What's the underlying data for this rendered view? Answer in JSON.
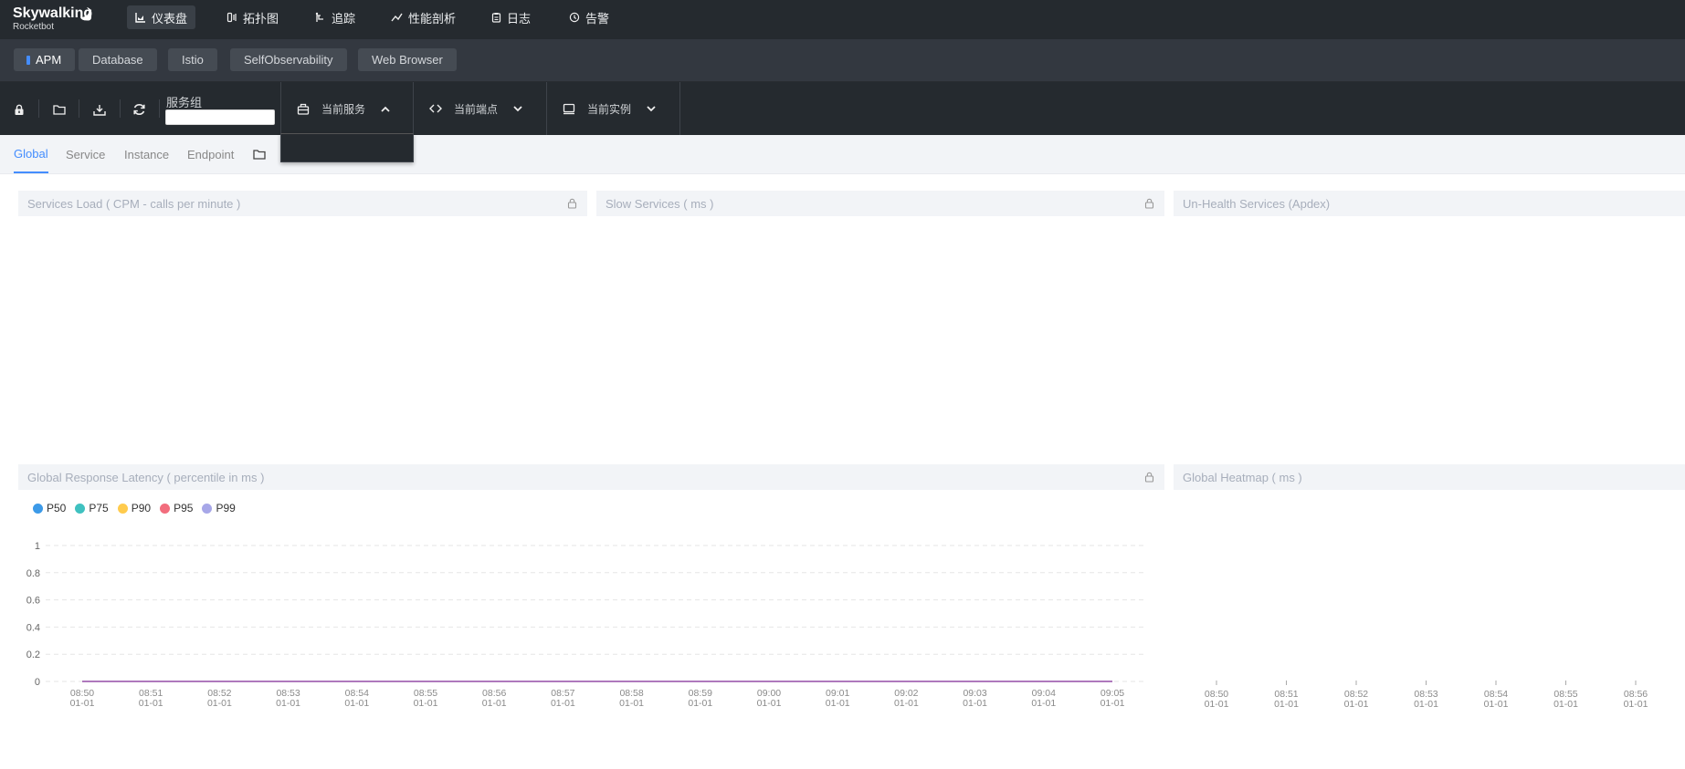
{
  "brand": {
    "name": "Skywalking",
    "sub": "Rocketbot"
  },
  "nav": [
    {
      "label": "仪表盘",
      "icon": "dashboard-chart-icon",
      "active": true
    },
    {
      "label": "拓扑图",
      "icon": "topology-icon",
      "active": false
    },
    {
      "label": "追踪",
      "icon": "trace-icon",
      "active": false
    },
    {
      "label": "性能剖析",
      "icon": "profile-trend-icon",
      "active": false
    },
    {
      "label": "日志",
      "icon": "log-clipboard-icon",
      "active": false
    },
    {
      "label": "告警",
      "icon": "alarm-clock-icon",
      "active": false
    }
  ],
  "layers": [
    {
      "label": "APM",
      "active": true
    },
    {
      "label": "Database",
      "active": false
    },
    {
      "label": "Istio",
      "active": false
    },
    {
      "label": "SelfObservability",
      "active": false
    },
    {
      "label": "Web Browser",
      "active": false
    }
  ],
  "toolbar": {
    "group_label": "服务组",
    "group_value": "",
    "service": "当前服务",
    "endpoint": "当前端点",
    "instance": "当前实例"
  },
  "tabs": [
    {
      "label": "Global",
      "active": true
    },
    {
      "label": "Service",
      "active": false
    },
    {
      "label": "Instance",
      "active": false
    },
    {
      "label": "Endpoint",
      "active": false
    }
  ],
  "cards": {
    "services_load": "Services Load ( CPM - calls per minute )",
    "slow_services": "Slow Services ( ms )",
    "unhealth": "Un-Health Services (Apdex)",
    "latency": "Global Response Latency ( percentile in ms )",
    "heatmap": "Global Heatmap ( ms )"
  },
  "colors": {
    "accent": "#448dfe",
    "topbar": "#252a2f",
    "layerbar": "#333840",
    "line": "#a16ccf"
  },
  "chart_data": [
    {
      "type": "line",
      "title": "Global Response Latency ( percentile in ms )",
      "x": [
        "08:50\n01-01",
        "08:51\n01-01",
        "08:52\n01-01",
        "08:53\n01-01",
        "08:54\n01-01",
        "08:55\n01-01",
        "08:56\n01-01",
        "08:57\n01-01",
        "08:58\n01-01",
        "08:59\n01-01",
        "09:00\n01-01",
        "09:01\n01-01",
        "09:02\n01-01",
        "09:03\n01-01",
        "09:04\n01-01",
        "09:05\n01-01"
      ],
      "yticks": [
        "0",
        "0.2",
        "0.4",
        "0.6",
        "0.8",
        "1"
      ],
      "ylim": [
        0,
        1
      ],
      "grid": true,
      "legend": "top-left",
      "series": [
        {
          "name": "P50",
          "color": "#3c9ae8",
          "values": [
            0,
            0,
            0,
            0,
            0,
            0,
            0,
            0,
            0,
            0,
            0,
            0,
            0,
            0,
            0,
            0
          ]
        },
        {
          "name": "P75",
          "color": "#3fc1c0",
          "values": [
            0,
            0,
            0,
            0,
            0,
            0,
            0,
            0,
            0,
            0,
            0,
            0,
            0,
            0,
            0,
            0
          ]
        },
        {
          "name": "P90",
          "color": "#ffcb4d",
          "values": [
            0,
            0,
            0,
            0,
            0,
            0,
            0,
            0,
            0,
            0,
            0,
            0,
            0,
            0,
            0,
            0
          ]
        },
        {
          "name": "P95",
          "color": "#f26d7d",
          "values": [
            0,
            0,
            0,
            0,
            0,
            0,
            0,
            0,
            0,
            0,
            0,
            0,
            0,
            0,
            0,
            0
          ]
        },
        {
          "name": "P99",
          "color": "#a7a7e8",
          "values": [
            0,
            0,
            0,
            0,
            0,
            0,
            0,
            0,
            0,
            0,
            0,
            0,
            0,
            0,
            0,
            0
          ]
        }
      ]
    },
    {
      "type": "heatmap",
      "title": "Global Heatmap ( ms )",
      "x": [
        "08:50\n01-01",
        "08:51\n01-01",
        "08:52\n01-01",
        "08:53\n01-01",
        "08:54\n01-01",
        "08:55\n01-01",
        "08:56\n01-01"
      ],
      "values": []
    }
  ]
}
